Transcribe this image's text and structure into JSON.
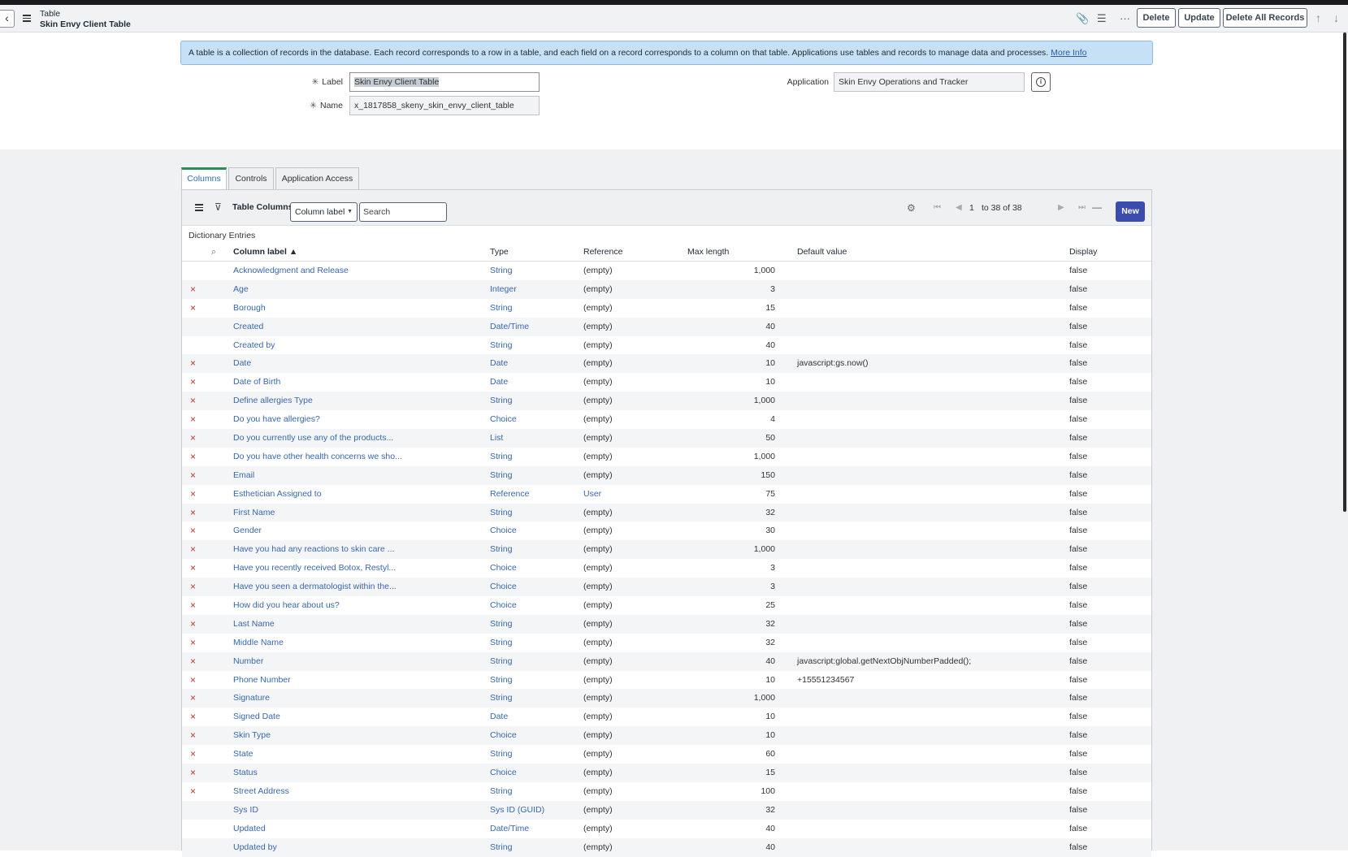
{
  "header": {
    "title": "Table",
    "subtitle": "Skin Envy Client Table",
    "buttons": {
      "delete": "Delete",
      "update": "Update",
      "delete_all": "Delete All Records"
    }
  },
  "banner": {
    "text": "A table is a collection of records in the database. Each record corresponds to a row in a table, and each field on a record corresponds to a column on that table. Applications use tables and records to manage data and processes.",
    "link": "More Info"
  },
  "form": {
    "label_caption": "Label",
    "label_value": "Skin Envy Client Table",
    "name_caption": "Name",
    "name_value": "x_1817858_skeny_skin_envy_client_table",
    "application_caption": "Application",
    "application_value": "Skin Envy Operations and Tracker",
    "required_mark": "✳"
  },
  "tabs": [
    "Columns",
    "Controls",
    "Application Access"
  ],
  "list": {
    "title": "Table Columns",
    "select_value": "Column label",
    "search_placeholder": "Search",
    "page_num": "1",
    "page_range": "to 38 of 38",
    "new_label": "New",
    "section_label": "Dictionary Entries",
    "headers": {
      "column_label": "Column label ▲",
      "type": "Type",
      "reference": "Reference",
      "max_length": "Max length",
      "default_value": "Default value",
      "display": "Display"
    },
    "rows": [
      {
        "del": "",
        "label": "Acknowledgment and Release",
        "type": "String",
        "ref": "(empty)",
        "max": "1,000",
        "def": "",
        "disp": "false"
      },
      {
        "del": "×",
        "label": "Age",
        "type": "Integer",
        "ref": "(empty)",
        "max": "3",
        "def": "",
        "disp": "false"
      },
      {
        "del": "×",
        "label": "Borough",
        "type": "String",
        "ref": "(empty)",
        "max": "15",
        "def": "",
        "disp": "false"
      },
      {
        "del": "",
        "label": "Created",
        "type": "Date/Time",
        "ref": "(empty)",
        "max": "40",
        "def": "",
        "disp": "false"
      },
      {
        "del": "",
        "label": "Created by",
        "type": "String",
        "ref": "(empty)",
        "max": "40",
        "def": "",
        "disp": "false"
      },
      {
        "del": "×",
        "label": "Date",
        "type": "Date",
        "ref": "(empty)",
        "max": "10",
        "def": "javascript:gs.now()",
        "disp": "false"
      },
      {
        "del": "×",
        "label": "Date of Birth",
        "type": "Date",
        "ref": "(empty)",
        "max": "10",
        "def": "",
        "disp": "false"
      },
      {
        "del": "×",
        "label": "Define allergies Type",
        "type": "String",
        "ref": "(empty)",
        "max": "1,000",
        "def": "",
        "disp": "false"
      },
      {
        "del": "×",
        "label": "Do you have allergies?",
        "type": "Choice",
        "ref": "(empty)",
        "max": "4",
        "def": "",
        "disp": "false"
      },
      {
        "del": "×",
        "label": "Do you currently use any of the products...",
        "type": "List",
        "ref": "(empty)",
        "max": "50",
        "def": "",
        "disp": "false"
      },
      {
        "del": "×",
        "label": "Do you have other health concerns we sho...",
        "type": "String",
        "ref": "(empty)",
        "max": "1,000",
        "def": "",
        "disp": "false"
      },
      {
        "del": "×",
        "label": "Email",
        "type": "String",
        "ref": "(empty)",
        "max": "150",
        "def": "",
        "disp": "false"
      },
      {
        "del": "×",
        "label": "Esthetician Assigned to",
        "type": "Reference",
        "ref": "User",
        "max": "75",
        "def": "",
        "disp": "false"
      },
      {
        "del": "×",
        "label": "First Name",
        "type": "String",
        "ref": "(empty)",
        "max": "32",
        "def": "",
        "disp": "false"
      },
      {
        "del": "×",
        "label": "Gender",
        "type": "Choice",
        "ref": "(empty)",
        "max": "30",
        "def": "",
        "disp": "false"
      },
      {
        "del": "×",
        "label": "Have you had any reactions to skin care ...",
        "type": "String",
        "ref": "(empty)",
        "max": "1,000",
        "def": "",
        "disp": "false"
      },
      {
        "del": "×",
        "label": "Have you recently received Botox, Restyl...",
        "type": "Choice",
        "ref": "(empty)",
        "max": "3",
        "def": "",
        "disp": "false"
      },
      {
        "del": "×",
        "label": "Have you seen a dermatologist within the...",
        "type": "Choice",
        "ref": "(empty)",
        "max": "3",
        "def": "",
        "disp": "false"
      },
      {
        "del": "×",
        "label": "How did you hear about us?",
        "type": "Choice",
        "ref": "(empty)",
        "max": "25",
        "def": "",
        "disp": "false"
      },
      {
        "del": "×",
        "label": "Last Name",
        "type": "String",
        "ref": "(empty)",
        "max": "32",
        "def": "",
        "disp": "false"
      },
      {
        "del": "×",
        "label": "Middle Name",
        "type": "String",
        "ref": "(empty)",
        "max": "32",
        "def": "",
        "disp": "false"
      },
      {
        "del": "×",
        "label": "Number",
        "type": "String",
        "ref": "(empty)",
        "max": "40",
        "def": "javascript:global.getNextObjNumberPadded();",
        "disp": "false"
      },
      {
        "del": "×",
        "label": "Phone Number",
        "type": "String",
        "ref": "(empty)",
        "max": "10",
        "def": "+15551234567",
        "disp": "false"
      },
      {
        "del": "×",
        "label": "Signature",
        "type": "String",
        "ref": "(empty)",
        "max": "1,000",
        "def": "",
        "disp": "false"
      },
      {
        "del": "×",
        "label": "Signed Date",
        "type": "Date",
        "ref": "(empty)",
        "max": "10",
        "def": "",
        "disp": "false"
      },
      {
        "del": "×",
        "label": "Skin Type",
        "type": "Choice",
        "ref": "(empty)",
        "max": "10",
        "def": "",
        "disp": "false"
      },
      {
        "del": "×",
        "label": "State",
        "type": "String",
        "ref": "(empty)",
        "max": "60",
        "def": "",
        "disp": "false"
      },
      {
        "del": "×",
        "label": "Status",
        "type": "Choice",
        "ref": "(empty)",
        "max": "15",
        "def": "",
        "disp": "false"
      },
      {
        "del": "×",
        "label": "Street Address",
        "type": "String",
        "ref": "(empty)",
        "max": "100",
        "def": "",
        "disp": "false"
      },
      {
        "del": "",
        "label": "Sys ID",
        "type": "Sys ID (GUID)",
        "ref": "(empty)",
        "max": "32",
        "def": "",
        "disp": "false"
      },
      {
        "del": "",
        "label": "Updated",
        "type": "Date/Time",
        "ref": "(empty)",
        "max": "40",
        "def": "",
        "disp": "false"
      },
      {
        "del": "",
        "label": "Updated by",
        "type": "String",
        "ref": "(empty)",
        "max": "40",
        "def": "",
        "disp": "false"
      }
    ]
  }
}
